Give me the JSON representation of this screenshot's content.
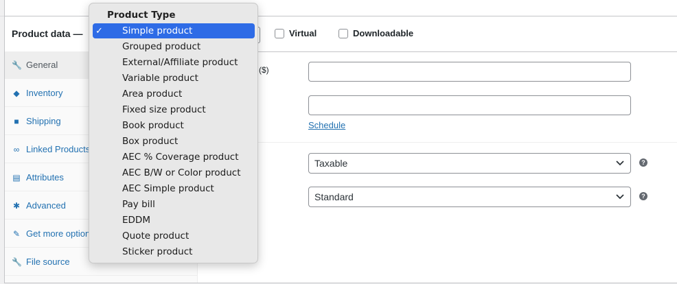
{
  "header": {
    "title": "Product data —",
    "virtual_label": "Virtual",
    "downloadable_label": "Downloadable"
  },
  "product_type_dropdown": {
    "header": "Product Type",
    "check_glyph": "✓",
    "selected_index": 0,
    "options": [
      "Simple product",
      "Grouped product",
      "External/Affiliate product",
      "Variable product",
      "Area product",
      "Fixed size product",
      "Book product",
      "Box product",
      "AEC % Coverage product",
      "AEC B/W or Color product",
      "AEC Simple product",
      "Pay bill",
      "EDDM",
      "Quote product",
      "Sticker product"
    ]
  },
  "tabs": [
    {
      "label": "General",
      "icon": "wrench-icon",
      "glyph": "🔧",
      "active": true
    },
    {
      "label": "Inventory",
      "icon": "tag-icon",
      "glyph": "◆",
      "active": false
    },
    {
      "label": "Shipping",
      "icon": "truck-icon",
      "glyph": "■",
      "active": false
    },
    {
      "label": "Linked Products",
      "icon": "link-icon",
      "glyph": "∞",
      "active": false
    },
    {
      "label": "Attributes",
      "icon": "list-icon",
      "glyph": "▤",
      "active": false
    },
    {
      "label": "Advanced",
      "icon": "gear-icon",
      "glyph": "✱",
      "active": false
    },
    {
      "label": "Get more options",
      "icon": "plug-icon",
      "glyph": "✎",
      "active": false
    },
    {
      "label": "File source",
      "icon": "wrench-icon",
      "glyph": "🔧",
      "active": false
    }
  ],
  "general": {
    "price_label_fragment": "($)",
    "regular_price_value": "",
    "sale_price_value": "",
    "schedule_link": "Schedule",
    "tax_status": "Taxable",
    "tax_class": "Standard",
    "help_glyph": "?"
  },
  "colors": {
    "link": "#2271b1",
    "selected_option": "#2e6be6",
    "border": "#c3c4c7"
  }
}
